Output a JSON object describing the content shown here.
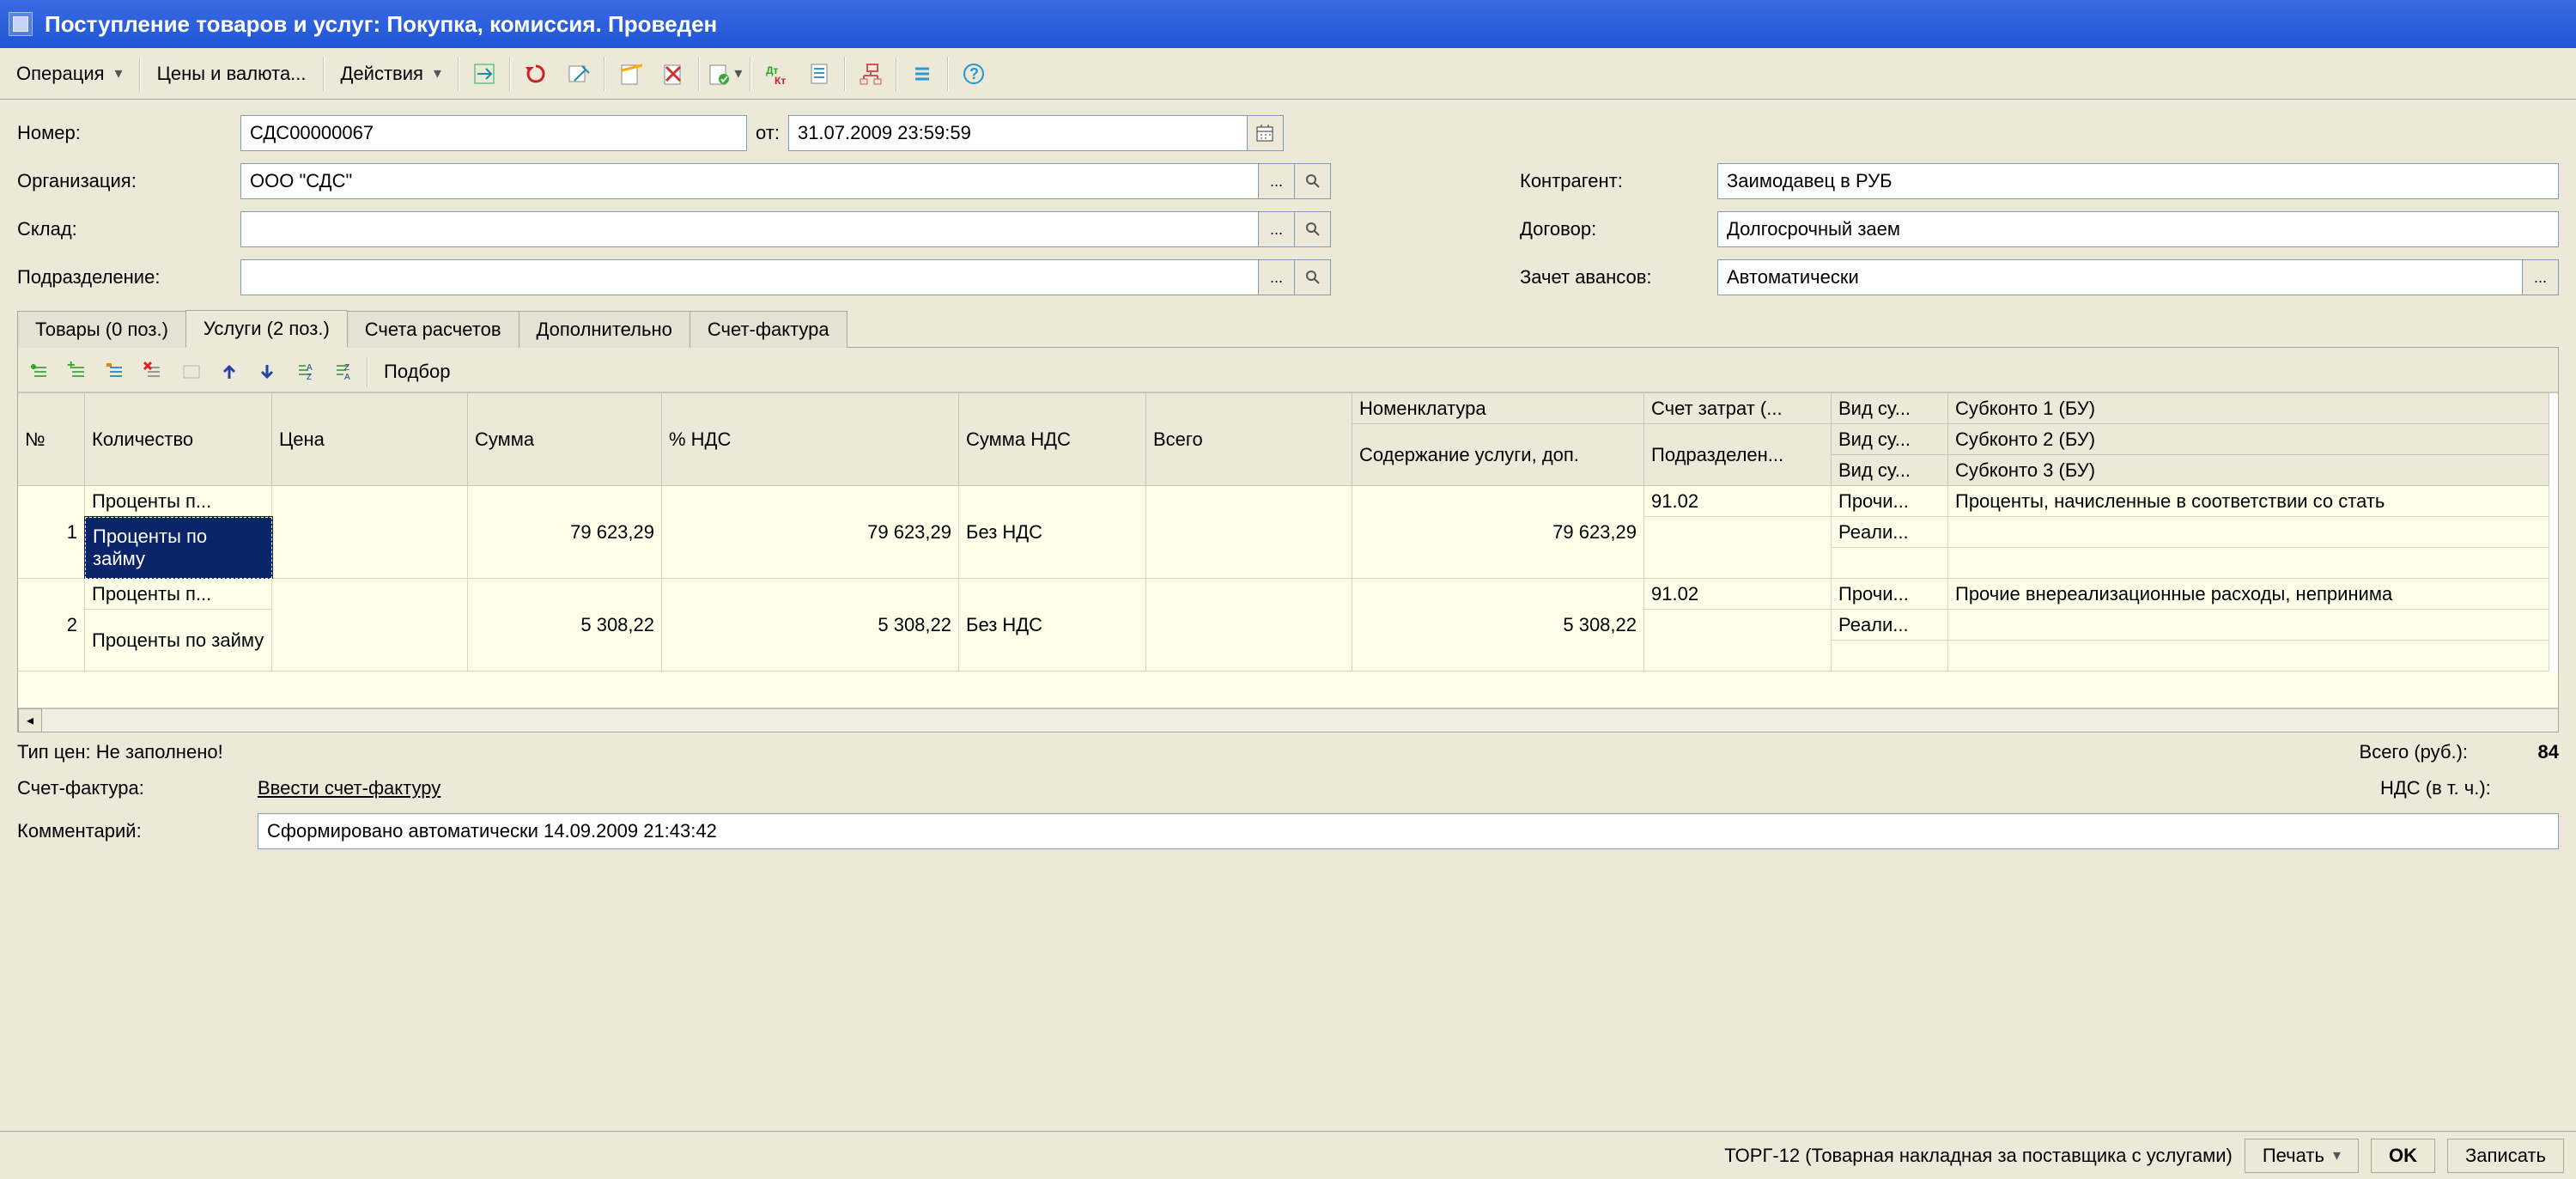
{
  "title": "Поступление товаров и услуг: Покупка, комиссия. Проведен",
  "toolbar": {
    "operation": "Операция",
    "prices": "Цены и валюта...",
    "actions": "Действия"
  },
  "form": {
    "number_label": "Номер:",
    "number": "СДС00000067",
    "from_label": "от:",
    "date": "31.07.2009 23:59:59",
    "org_label": "Организация:",
    "org": "ООО \"СДС\"",
    "warehouse_label": "Склад:",
    "warehouse": "",
    "dept_label": "Подразделение:",
    "dept": "",
    "contractor_label": "Контрагент:",
    "contractor": "Заимодавец в РУБ",
    "contract_label": "Договор:",
    "contract": "Долгосрочный заем",
    "advance_label": "Зачет авансов:",
    "advance": "Автоматически"
  },
  "tabs": {
    "goods": "Товары (0 поз.)",
    "services": "Услуги (2 поз.)",
    "accounts": "Счета расчетов",
    "extra": "Дополнительно",
    "invoice": "Счет-фактура"
  },
  "grid_toolbar": {
    "select": "Подбор"
  },
  "grid": {
    "headers": {
      "n": "№",
      "nomen": "Номенклатура",
      "content": "Содержание услуги, доп.",
      "qty": "Количество",
      "price": "Цена",
      "sum": "Сумма",
      "vat": "% НДС",
      "vatsum": "Сумма НДС",
      "total": "Всего",
      "acct": "Счет затрат (...",
      "dept2": "Подразделен...",
      "expkind1": "Вид су...",
      "expkind2": "Вид су...",
      "expkind3": "Вид су...",
      "sub1": "Субконто 1 (БУ)",
      "sub2": "Субконто 2 (БУ)",
      "sub3": "Субконто 3 (БУ)"
    },
    "rows": [
      {
        "n": "1",
        "nomen": "Проценты п...",
        "content": "Проценты по займу",
        "price": "79 623,29",
        "sum": "79 623,29",
        "vat": "Без НДС",
        "total": "79 623,29",
        "acct": "91.02",
        "exp1": "Прочи...",
        "exp2": "Реали...",
        "sub1": "Проценты, начисленные в соответствии со стать"
      },
      {
        "n": "2",
        "nomen": "Проценты п...",
        "content": "Проценты по займу",
        "price": "5 308,22",
        "sum": "5 308,22",
        "vat": "Без НДС",
        "total": "5 308,22",
        "acct": "91.02",
        "exp1": "Прочи...",
        "exp2": "Реали...",
        "sub1": "Прочие внереализационные расходы, непринима"
      }
    ]
  },
  "footer": {
    "pricetype": "Тип цен: Не заполнено!",
    "invoice_label": "Счет-фактура:",
    "invoice_link": "Ввести счет-фактуру",
    "comment_label": "Комментарий:",
    "comment": "Сформировано автоматически 14.09.2009 21:43:42",
    "total_label": "Всего (руб.):",
    "total_value": "84",
    "vat_label": "НДС (в т. ч.):"
  },
  "bottom": {
    "form_name": "ТОРГ-12 (Товарная накладная за поставщика с услугами)",
    "print": "Печать",
    "ok": "OK",
    "save": "Записать"
  }
}
